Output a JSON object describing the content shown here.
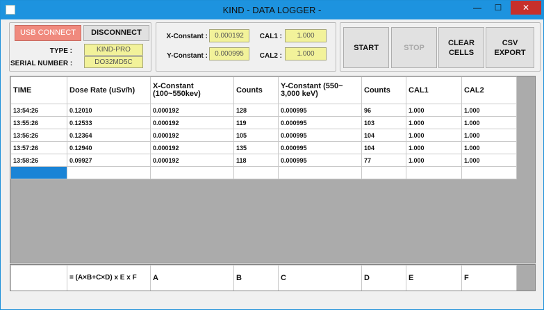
{
  "window": {
    "title": "KIND - DATA LOGGER -",
    "minimize": "—",
    "maximize": "☐",
    "close": "✕"
  },
  "connection": {
    "usb_connect": "USB CONNECT",
    "disconnect": "DISCONNECT",
    "type_label": "TYPE :",
    "type_value": "KIND-PRO",
    "serial_label": "SERIAL NUMBER :",
    "serial_value": "DO32MD5C"
  },
  "constants": {
    "x_label": "X-Constant :",
    "x_value": "0.000192",
    "y_label": "Y-Constant :",
    "y_value": "0.000995",
    "cal1_label": "CAL1 :",
    "cal1_value": "1.000",
    "cal2_label": "CAL2 :",
    "cal2_value": "1.000"
  },
  "controls": {
    "start": "START",
    "stop": "STOP",
    "clear": "CLEAR CELLS",
    "csv": "CSV EXPORT"
  },
  "grid": {
    "headers": [
      "TIME",
      "Dose Rate (uSv/h)",
      "X-Constant (100~550kev)",
      "Counts",
      "Y-Constant (550~ 3,000 keV)",
      "Counts",
      "CAL1",
      "CAL2"
    ],
    "rows": [
      [
        "13:54:26",
        "0.12010",
        "0.000192",
        "128",
        "0.000995",
        "96",
        "1.000",
        "1.000"
      ],
      [
        "13:55:26",
        "0.12533",
        "0.000192",
        "119",
        "0.000995",
        "103",
        "1.000",
        "1.000"
      ],
      [
        "13:56:26",
        "0.12364",
        "0.000192",
        "105",
        "0.000995",
        "104",
        "1.000",
        "1.000"
      ],
      [
        "13:57:26",
        "0.12940",
        "0.000192",
        "135",
        "0.000995",
        "104",
        "1.000",
        "1.000"
      ],
      [
        "13:58:26",
        "0.09927",
        "0.000192",
        "118",
        "0.000995",
        "77",
        "1.000",
        "1.000"
      ]
    ]
  },
  "footer": {
    "formula": "= (A×B+C×D) x E x F",
    "cells": [
      "A",
      "B",
      "C",
      "D",
      "E",
      "F"
    ]
  },
  "colors": {
    "titlebar": "#1d93df",
    "usb_button": "#f08a7e",
    "field": "#f2f29a",
    "selection": "#1a84d6",
    "close": "#c7302b"
  }
}
